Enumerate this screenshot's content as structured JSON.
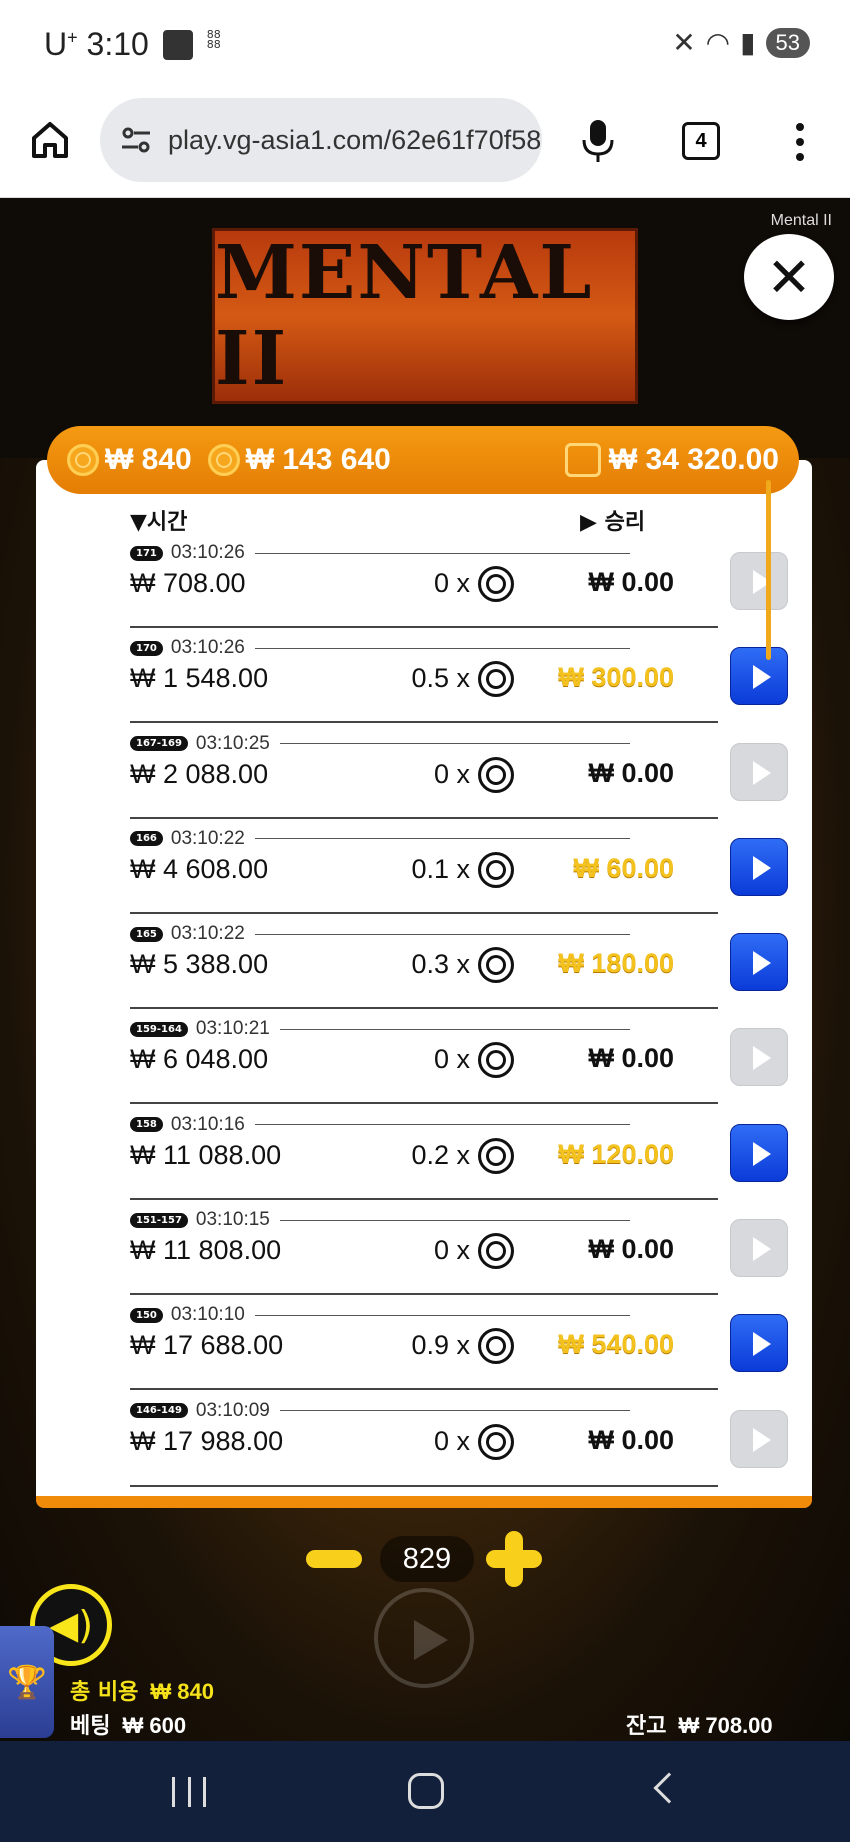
{
  "status": {
    "carrier": "U",
    "carrier_sup": "+",
    "time": "3:10",
    "battery": "53"
  },
  "browser": {
    "url": "play.vg-asia1.com/62e61f70f58",
    "tab_count": "4"
  },
  "game": {
    "label": "Mental II",
    "logo_text": "MENTAL II",
    "top_bar": {
      "cost": "₩ 840",
      "total": "₩ 143 640",
      "balance": "₩ 34 320.00"
    },
    "header": {
      "time": "▼시간",
      "win": "▶ 승리"
    },
    "rows": [
      {
        "id": "171",
        "time": "03:10:26",
        "bet": "₩ 708.00",
        "mult": "0 x",
        "win": "₩ 0.00",
        "gold": false
      },
      {
        "id": "170",
        "time": "03:10:26",
        "bet": "₩ 1 548.00",
        "mult": "0.5 x",
        "win": "₩ 300.00",
        "gold": true
      },
      {
        "id": "167-169",
        "time": "03:10:25",
        "bet": "₩ 2 088.00",
        "mult": "0 x",
        "win": "₩ 0.00",
        "gold": false
      },
      {
        "id": "166",
        "time": "03:10:22",
        "bet": "₩ 4 608.00",
        "mult": "0.1 x",
        "win": "₩ 60.00",
        "gold": true
      },
      {
        "id": "165",
        "time": "03:10:22",
        "bet": "₩ 5 388.00",
        "mult": "0.3 x",
        "win": "₩ 180.00",
        "gold": true
      },
      {
        "id": "159-164",
        "time": "03:10:21",
        "bet": "₩ 6 048.00",
        "mult": "0 x",
        "win": "₩ 0.00",
        "gold": false
      },
      {
        "id": "158",
        "time": "03:10:16",
        "bet": "₩ 11 088.00",
        "mult": "0.2 x",
        "win": "₩ 120.00",
        "gold": true
      },
      {
        "id": "151-157",
        "time": "03:10:15",
        "bet": "₩ 11 808.00",
        "mult": "0 x",
        "win": "₩ 0.00",
        "gold": false
      },
      {
        "id": "150",
        "time": "03:10:10",
        "bet": "₩ 17 688.00",
        "mult": "0.9 x",
        "win": "₩ 540.00",
        "gold": true
      },
      {
        "id": "146-149",
        "time": "03:10:09",
        "bet": "₩ 17 988.00",
        "mult": "0 x",
        "win": "₩ 0.00",
        "gold": false
      }
    ],
    "stepper_value": "829",
    "footer": {
      "cost_label": "총 비용",
      "cost_value": "₩ 840",
      "bet_label": "베팅",
      "bet_value": "₩ 600",
      "balance_label": "잔고",
      "balance_value": "₩ 708.00"
    }
  }
}
